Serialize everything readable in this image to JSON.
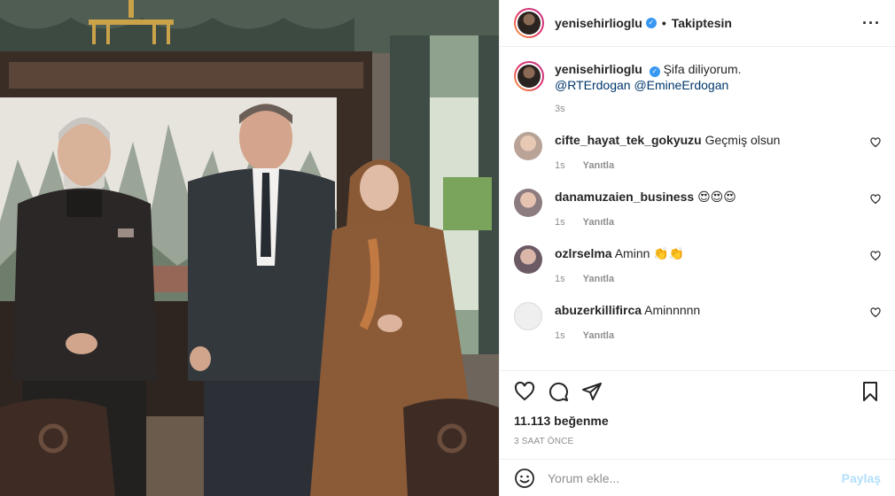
{
  "post": {
    "username": "yenisehirlioglu",
    "follow_state": "Takiptesin",
    "dot": "•",
    "more_icon": "more-horizontal-icon"
  },
  "caption": {
    "username": "yenisehirlioglu",
    "text": "Şifa diliyorum.",
    "mentions": "@RTErdogan @EmineErdogan",
    "time": "3s"
  },
  "comments": [
    {
      "username": "cifte_hayat_tek_gokyuzu",
      "text": "Geçmiş olsun",
      "time": "1s",
      "reply": "Yanıtla"
    },
    {
      "username": "danamuzaien_business",
      "text": "😍😍😍",
      "time": "1s",
      "reply": "Yanıtla"
    },
    {
      "username": "ozlrselma",
      "text": "Aminn 👏👏",
      "time": "1s",
      "reply": "Yanıtla"
    },
    {
      "username": "abuzerkillifirca",
      "text": "Aminnnnn",
      "time": "1s",
      "reply": "Yanıtla"
    }
  ],
  "stats": {
    "likes": "11.113 beğenme",
    "posted": "3 SAAT ÖNCE"
  },
  "composer": {
    "placeholder": "Yorum ekle...",
    "submit": "Paylaş"
  },
  "colors": {
    "verified": "#3897f0",
    "link": "#00376b",
    "muted": "#8e8e8e",
    "share_disabled": "#b2dffc"
  }
}
